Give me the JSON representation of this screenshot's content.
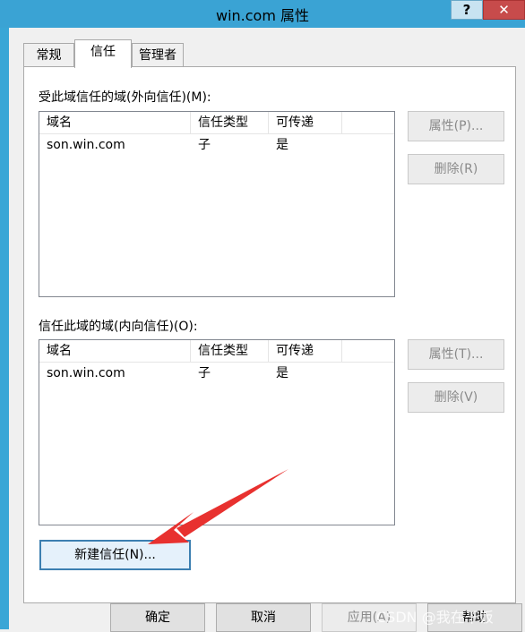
{
  "window": {
    "title": "win.com 属性",
    "help_label": "?",
    "close_label": "✕"
  },
  "tabs": [
    {
      "label": "常规"
    },
    {
      "label": "信任"
    },
    {
      "label": "管理者"
    }
  ],
  "outgoing": {
    "label": "受此域信任的域(外向信任)(M):",
    "columns": [
      "域名",
      "信任类型",
      "可传递"
    ],
    "rows": [
      {
        "domain": "son.win.com",
        "type": "子",
        "transitive": "是"
      }
    ],
    "properties_label": "属性(P)...",
    "remove_label": "删除(R)"
  },
  "incoming": {
    "label": "信任此域的域(内向信任)(O):",
    "columns": [
      "域名",
      "信任类型",
      "可传递"
    ],
    "rows": [
      {
        "domain": "son.win.com",
        "type": "子",
        "transitive": "是"
      }
    ],
    "properties_label": "属性(T)...",
    "remove_label": "删除(V)"
  },
  "new_trust_label": "新建信任(N)...",
  "footer": {
    "ok": "确定",
    "cancel": "取消",
    "apply": "应用(A)",
    "help": "帮助"
  },
  "watermark": "CSDN @我在干饭",
  "colors": {
    "title_bar": "#3aa3d4",
    "arrow": "#e8312f",
    "close_button": "#c74b4b"
  }
}
